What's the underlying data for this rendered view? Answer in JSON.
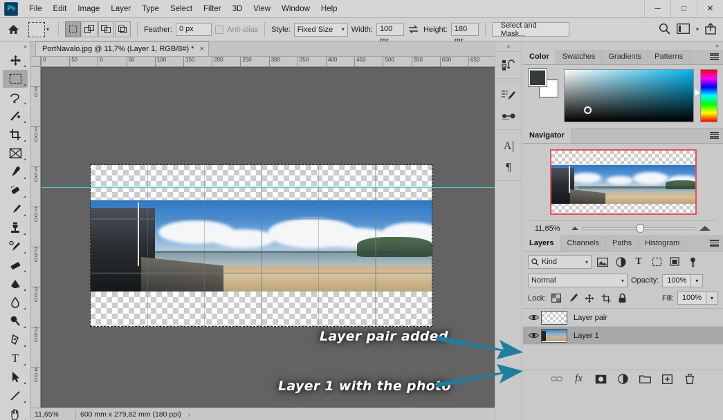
{
  "app": {
    "logo": "Ps"
  },
  "menubar": {
    "items": [
      "File",
      "Edit",
      "Image",
      "Layer",
      "Type",
      "Select",
      "Filter",
      "3D",
      "View",
      "Window",
      "Help"
    ],
    "window_controls": [
      "minimize",
      "maximize",
      "close"
    ]
  },
  "options_bar": {
    "home_icon": "home-icon",
    "tool_preset_icon": "marquee-tool-preset",
    "selection_modes": [
      "new-selection",
      "add-to-selection",
      "subtract-from-selection",
      "intersect-with-selection"
    ],
    "selection_mode_active": 0,
    "feather_label": "Feather:",
    "feather_value": "0 px",
    "antialias_label": "Anti-alias",
    "antialias_enabled": false,
    "style_label": "Style:",
    "style_value": "Fixed Size",
    "width_label": "Width:",
    "width_value": "100 mr",
    "swap_icon": "swap-width-height-icon",
    "height_label": "Height:",
    "height_value": "180 mr",
    "select_and_mask": "Select and Mask...",
    "right_icons": [
      "search-icon",
      "workspace-icon",
      "chevron-down-icon",
      "share-icon"
    ]
  },
  "toolbar": {
    "collapse_glyph": "»",
    "tools": [
      {
        "name": "move-tool",
        "glyph": "✥",
        "active": false
      },
      {
        "name": "rectangular-marquee-tool",
        "glyph": "⬚",
        "active": true
      },
      {
        "name": "lasso-tool",
        "glyph": "❦",
        "active": false
      },
      {
        "name": "magic-wand-tool",
        "glyph": "✦",
        "active": false
      },
      {
        "name": "crop-tool",
        "glyph": "⌧",
        "active": false
      },
      {
        "name": "frame-tool",
        "glyph": "☒",
        "active": false
      },
      {
        "name": "eyedropper-tool",
        "glyph": "✐",
        "active": false
      },
      {
        "name": "spot-healing-brush-tool",
        "glyph": "❁",
        "active": false
      },
      {
        "name": "brush-tool",
        "glyph": "✎",
        "active": false
      },
      {
        "name": "clone-stamp-tool",
        "glyph": "⚑",
        "active": false
      },
      {
        "name": "history-brush-tool",
        "glyph": "✒",
        "active": false
      },
      {
        "name": "eraser-tool",
        "glyph": "▰",
        "active": false
      },
      {
        "name": "gradient-tool",
        "glyph": "◧",
        "active": false
      },
      {
        "name": "blur-tool",
        "glyph": "◍",
        "active": false
      },
      {
        "name": "dodge-tool",
        "glyph": "●",
        "active": false
      },
      {
        "name": "pen-tool",
        "glyph": "✒",
        "active": false
      },
      {
        "name": "horizontal-type-tool",
        "glyph": "T",
        "active": false
      },
      {
        "name": "path-selection-tool",
        "glyph": "➤",
        "active": false
      },
      {
        "name": "line-tool",
        "glyph": "╱",
        "active": false
      },
      {
        "name": "hand-tool",
        "glyph": "✋",
        "active": false
      }
    ]
  },
  "document": {
    "tab_title": "PortNavalo.jpg @ 11,7% (Layer 1, RGB/8#) *",
    "close_glyph": "×",
    "ruler_h_ticks": [
      "0",
      "50",
      "0",
      "50",
      "100",
      "150",
      "200",
      "250",
      "300",
      "350",
      "400",
      "450",
      "500",
      "550",
      "600",
      "650"
    ],
    "ruler_v_ticks": [
      "50",
      "100",
      "150",
      "200",
      "250",
      "300",
      "350",
      "400"
    ]
  },
  "statusbar": {
    "zoom": "11,65%",
    "doc_size": "600 mm x 279,82 mm (180 ppi)",
    "expand_glyph": "›"
  },
  "icon_strip": {
    "collapse_glyph": "«",
    "buttons": [
      {
        "name": "history-panel-icon",
        "glyph": "↺"
      },
      {
        "name": "brush-settings-icon",
        "glyph": "✎"
      },
      {
        "name": "brushes-panel-icon",
        "glyph": "✒"
      },
      {
        "name": "character-panel-icon",
        "glyph": "A"
      },
      {
        "name": "paragraph-panel-icon",
        "glyph": "¶"
      }
    ]
  },
  "color_panel": {
    "collapse_glyph": "»",
    "tabs": [
      "Color",
      "Swatches",
      "Gradients",
      "Patterns"
    ],
    "active_tab": "Color",
    "menu_icon": "panel-menu-icon",
    "foreground_color": "#333b3d",
    "background_color": "#ffffff"
  },
  "navigator_panel": {
    "tabs": [
      "Navigator"
    ],
    "active_tab": "Navigator",
    "menu_icon": "panel-menu-icon",
    "zoom_value": "11,65%",
    "view_box_color": "#e8505a"
  },
  "layers_panel": {
    "tabs": [
      "Layers",
      "Channels",
      "Paths",
      "Histogram"
    ],
    "active_tab": "Layers",
    "menu_icon": "panel-menu-icon",
    "filter_kind": "Kind",
    "filter_icons": [
      "filter-pixel-icon",
      "filter-adjustment-icon",
      "filter-type-icon",
      "filter-shape-icon",
      "filter-smart-object-icon",
      "filter-toggle-icon"
    ],
    "blend_mode": "Normal",
    "opacity_label": "Opacity:",
    "opacity_value": "100%",
    "lock_label": "Lock:",
    "lock_icons": [
      "lock-transparent-pixels-icon",
      "lock-image-pixels-icon",
      "lock-position-icon",
      "lock-artboard-icon",
      "lock-all-icon"
    ],
    "fill_label": "Fill:",
    "fill_value": "100%",
    "layers": [
      {
        "name": "Layer pair",
        "visible": true,
        "selected": false,
        "thumb": "transparent"
      },
      {
        "name": "Layer 1",
        "visible": true,
        "selected": true,
        "thumb": "photo"
      }
    ],
    "footer_icons": [
      "link-layers-icon",
      "add-layer-style-icon",
      "add-layer-mask-icon",
      "new-adjustment-layer-icon",
      "new-group-icon",
      "new-layer-icon",
      "delete-layer-icon"
    ]
  },
  "annotations": {
    "arrow_color": "#1b7fa0",
    "note_1": "Layer pair added",
    "note_2": "Layer 1 with the photo"
  }
}
